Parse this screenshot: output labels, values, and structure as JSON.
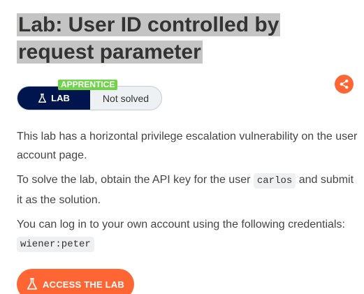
{
  "lab": {
    "title": "Lab: User ID controlled by request parameter",
    "level": "APPRENTICE",
    "type_label": "LAB",
    "status": "Not solved"
  },
  "description": {
    "p1": "This lab has a horizontal privilege escalation vulnerability on the user account page.",
    "p2_before": "To solve the lab, obtain the API key for the user",
    "p2_code": "carlos",
    "p2_after": "and submit it as the solution.",
    "p3_text": "You can log in to your own account using the following credentials:",
    "p3_code": "wiener:peter"
  },
  "actions": {
    "access_label": "ACCESS THE LAB"
  },
  "icons": {
    "share": "share-icon",
    "flask": "flask-icon"
  },
  "colors": {
    "accent": "#ff6633",
    "navy": "#00144d",
    "level_green": "#70d44b",
    "title_highlight": "#c4c4c4"
  }
}
